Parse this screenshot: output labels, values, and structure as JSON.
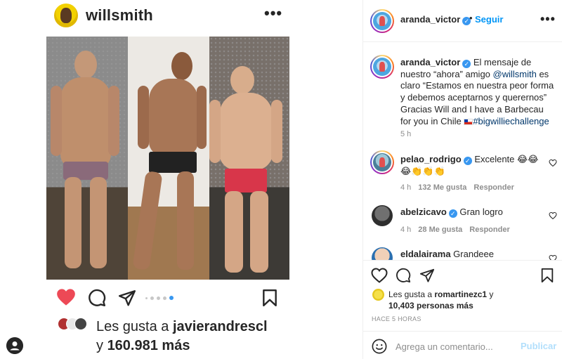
{
  "left_post": {
    "username": "willsmith",
    "more": "•••",
    "likes_line1_prefix": "Les gusta a ",
    "likes_line1_user": "javierandrescl",
    "likes_line2_prefix": "y ",
    "likes_line2_count": "160.981 más"
  },
  "header": {
    "username": "aranda_victor",
    "separator": "•",
    "follow_label": "Seguir",
    "more": "•••"
  },
  "caption": {
    "username": "aranda_victor",
    "text_1": " El mensaje de nuestro “ahora” amigo ",
    "mention": "@willsmith",
    "text_2": " es claro “Estamos en nuestra peor forma y debemos aceptarnos y querernos” Gracias Will and I have a Barbecau for you in Chile ",
    "hashtag": "#bigwilliechallenge",
    "time": "5 h"
  },
  "comments": [
    {
      "username": "pelao_rodrigo",
      "text": "Excelente 😂😂😂👏👏👏",
      "time": "4 h",
      "likes": "132 Me gusta",
      "reply": "Responder"
    },
    {
      "username": "abelzicavo",
      "text": "Gran logro",
      "time": "4 h",
      "likes": "28 Me gusta",
      "reply": "Responder"
    },
    {
      "username": "eldalairama",
      "text": "Grandeee"
    }
  ],
  "likes": {
    "prefix": "Les gusta a ",
    "user": "romartinezc1",
    "middle": " y ",
    "count": "10,403 personas más"
  },
  "timestamp": "HACE 5 HORAS",
  "comment_box": {
    "placeholder": "Agrega un comentario...",
    "post_label": "Publicar"
  },
  "colors": {
    "link_blue": "#0095f6",
    "like_red": "#ed4956",
    "muted": "#8e8e8e"
  }
}
